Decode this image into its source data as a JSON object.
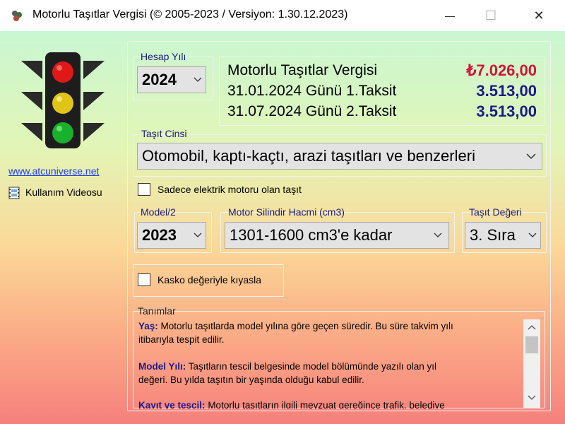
{
  "window": {
    "title": "Motorlu Taşıtlar Vergisi (©  2005-2023 / Versiyon: 1.30.12.2023)",
    "minimize_glyph": "—",
    "maximize_glyph": "☐",
    "close_glyph": "✕"
  },
  "sidebar": {
    "website_link": "www.atcuniverse.net",
    "video_link": "Kullanım Videosu"
  },
  "hesap_yili": {
    "label": "Hesap Yılı",
    "value": "2024"
  },
  "summary": {
    "title": "Motorlu Taşıtlar Vergisi",
    "total_amount": "₺7.026,00",
    "installment1_label": "31.01.2024  Günü 1.Taksit",
    "installment1_amount": "3.513,00",
    "installment2_label": "31.07.2024  Günü 2.Taksit",
    "installment2_amount": "3.513,00"
  },
  "vehicle_type": {
    "label": "Taşıt Cinsi",
    "value": "Otomobil, kaptı-kaçtı, arazi taşıtları ve benzerleri"
  },
  "electric_checkbox": {
    "label": "Sadece elektrik motoru olan taşıt",
    "checked": false
  },
  "model": {
    "label": "Model/2",
    "value": "2023"
  },
  "engine": {
    "label": "Motor Silindir Hacmi (cm3)",
    "value": "1301-1600 cm3'e kadar"
  },
  "vehicle_value": {
    "label": "Taşıt Değeri",
    "value": "3. Sıra"
  },
  "kasko_checkbox": {
    "label": "Kasko değeriyle kıyasla",
    "checked": false
  },
  "definitions": {
    "label": "Tanımlar",
    "term1": "Yaş:",
    "text1a": "Motorlu taşıtlarda model yılına göre geçen süredir. Bu süre takvim yılı",
    "text1b": "itibarıyla tespit edilir.",
    "term2": "Model Yılı:",
    "text2a": "Taşıtların tescil belgesinde model bölümünde yazılı olan yıl",
    "text2b": "değeri. Bu yılda taşıtın bir yaşında olduğu kabul edilir.",
    "term3": "Kayıt ve tescil:",
    "text3a": "Motorlu taşıtların ilgili mevzuat gereğince trafik, belediye"
  },
  "colors": {
    "total_amount": "#d4143a",
    "installment_amount": "#1a1a8a",
    "group_label": "#1a1a7a",
    "link": "#1a3cff"
  }
}
